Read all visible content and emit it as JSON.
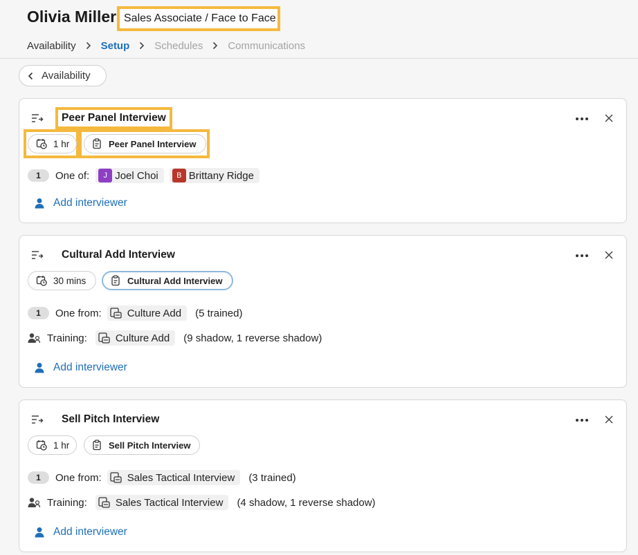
{
  "header": {
    "name": "Olivia Miller",
    "role": "Sales Associate / Face to Face"
  },
  "breadcrumb": [
    {
      "label": "Availability",
      "state": "done"
    },
    {
      "label": "Setup",
      "state": "active"
    },
    {
      "label": "Schedules",
      "state": "disabled"
    },
    {
      "label": "Communications",
      "state": "disabled"
    }
  ],
  "back_button": {
    "label": "Availability"
  },
  "cards": [
    {
      "title": "Peer Panel Interview",
      "duration": "1 hr",
      "interview_type": "Peer Panel Interview",
      "pool": {
        "count": "1",
        "label": "One of:",
        "interviewers": [
          {
            "initial": "J",
            "name": "Joel Choi",
            "color": "#8e3fc4"
          },
          {
            "initial": "B",
            "name": "Brittany Ridge",
            "color": "#b8352a"
          }
        ]
      },
      "add_label": "Add interviewer"
    },
    {
      "title": "Cultural Add Interview",
      "duration": "30 mins",
      "interview_type": "Cultural Add Interview",
      "pool": {
        "count": "1",
        "label": "One from:",
        "group": "Culture Add",
        "note": "(5 trained)"
      },
      "training": {
        "label": "Training:",
        "group": "Culture Add",
        "note": "(9 shadow, 1 reverse shadow)"
      },
      "add_label": "Add interviewer"
    },
    {
      "title": "Sell Pitch Interview",
      "duration": "1 hr",
      "interview_type": "Sell Pitch Interview",
      "pool": {
        "count": "1",
        "label": "One from:",
        "group": "Sales Tactical Interview",
        "note": "(3 trained)"
      },
      "training": {
        "label": "Training:",
        "group": "Sales Tactical Interview",
        "note": "(4 shadow, 1 reverse shadow)"
      },
      "add_label": "Add interviewer"
    }
  ],
  "colors": {
    "accent": "#1f6fb8",
    "highlight": "#f5b93e"
  }
}
